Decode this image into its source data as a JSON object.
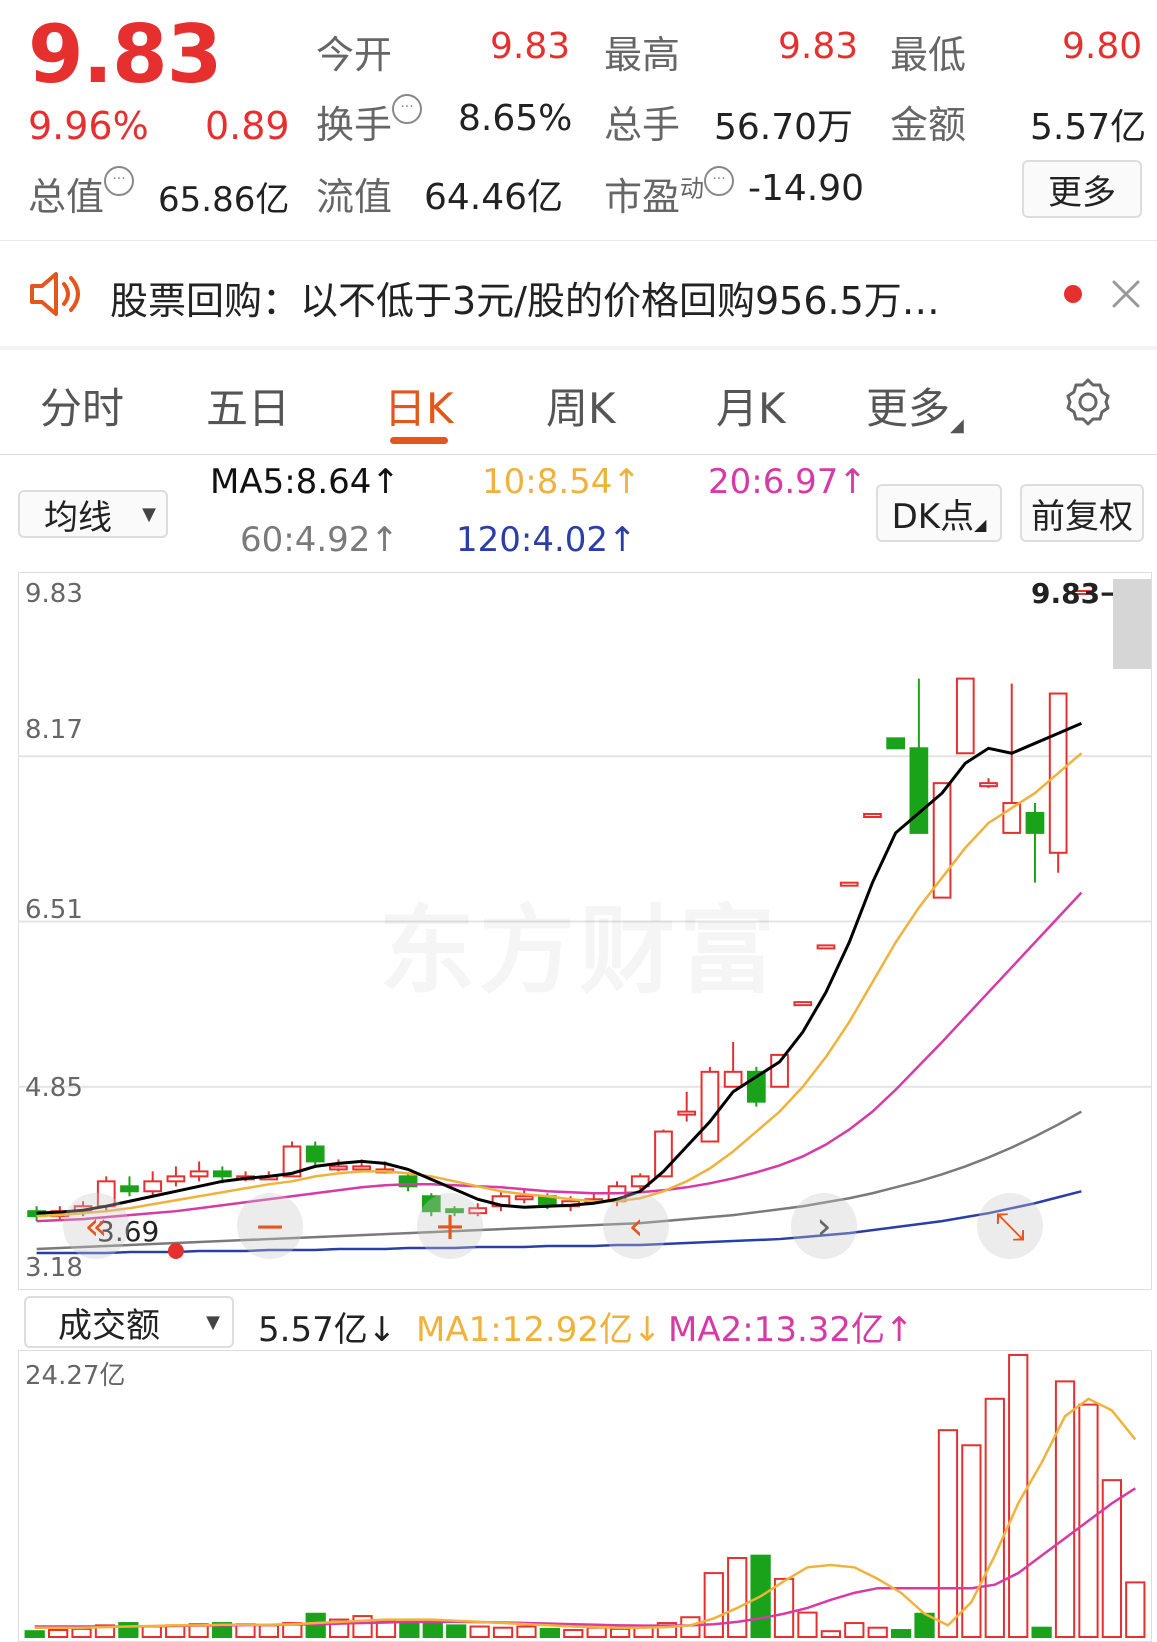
{
  "quote": {
    "price": "9.83",
    "change_pct": "9.96%",
    "change": "0.89",
    "open_label": "今开",
    "open": "9.83",
    "high_label": "最高",
    "high": "9.83",
    "low_label": "最低",
    "low": "9.80",
    "turnover_label": "换手",
    "turnover": "8.65%",
    "volume_label": "总手",
    "volume": "56.70万",
    "amount_label": "金额",
    "amount": "5.57亿",
    "mktcap_label": "总值",
    "mktcap": "65.86亿",
    "float_label": "流值",
    "float_cap": "64.46亿",
    "pe_label": "市盈",
    "pe_sup": "动",
    "pe": "-14.90",
    "more_label": "更多"
  },
  "notice": {
    "text": "股票回购：以不低于3元/股的价格回购956.5万…",
    "speaker_icon": "speaker-icon",
    "close_icon": "close-icon"
  },
  "tabs": [
    {
      "label": "分时"
    },
    {
      "label": "五日"
    },
    {
      "label": "日K"
    },
    {
      "label": "周K"
    },
    {
      "label": "月K"
    },
    {
      "label": "更多"
    }
  ],
  "active_tab": 2,
  "ma_bar": {
    "selector": "均线",
    "ma5": "MA5:8.64",
    "ma10": "10:8.54",
    "ma20": "20:6.97",
    "ma60": "60:4.92",
    "ma120": "120:4.02",
    "dk_label": "DK点",
    "fq_label": "前复权",
    "arrow_up": "↑"
  },
  "price_chart": {
    "y_labels": [
      "9.83",
      "8.17",
      "6.51",
      "4.85",
      "3.18"
    ],
    "max_label": "9.83",
    "min_label": "3.69",
    "watermark": "东方财富"
  },
  "volume_bar": {
    "selector": "成交额",
    "value": "5.57亿",
    "ma1": "MA1:12.92亿",
    "ma2": "MA2:13.32亿",
    "down_arrow": "↓",
    "up_arrow": "↑",
    "max_label": "24.27亿"
  },
  "colors": {
    "up": "#e6302f",
    "down": "#1aa31a",
    "ma5": "#000000",
    "ma10": "#f0b23c",
    "ma20": "#d63aa4",
    "ma60": "#7a7a7a",
    "ma120": "#2a3ea8",
    "accent": "#e4571c"
  },
  "chart_data": {
    "type": "candlestick",
    "y_range": [
      3.18,
      9.83
    ],
    "candles": [
      {
        "o": 3.6,
        "c": 3.55,
        "h": 3.65,
        "l": 3.5
      },
      {
        "o": 3.55,
        "c": 3.6,
        "h": 3.65,
        "l": 3.5
      },
      {
        "o": 3.6,
        "c": 3.65,
        "h": 3.7,
        "l": 3.55
      },
      {
        "o": 3.65,
        "c": 3.9,
        "h": 3.95,
        "l": 3.6
      },
      {
        "o": 3.85,
        "c": 3.8,
        "h": 3.95,
        "l": 3.75
      },
      {
        "o": 3.8,
        "c": 3.9,
        "h": 4.0,
        "l": 3.75
      },
      {
        "o": 3.9,
        "c": 3.95,
        "h": 4.05,
        "l": 3.85
      },
      {
        "o": 3.95,
        "c": 4.0,
        "h": 4.1,
        "l": 3.9
      },
      {
        "o": 4.0,
        "c": 3.95,
        "h": 4.05,
        "l": 3.88
      },
      {
        "o": 3.95,
        "c": 3.95,
        "h": 4.0,
        "l": 3.9
      },
      {
        "o": 3.95,
        "c": 3.95,
        "h": 4.0,
        "l": 3.92
      },
      {
        "o": 3.95,
        "c": 4.25,
        "h": 4.3,
        "l": 3.95
      },
      {
        "o": 4.25,
        "c": 4.1,
        "h": 4.3,
        "l": 4.05
      },
      {
        "o": 4.05,
        "c": 4.05,
        "h": 4.12,
        "l": 4.0
      },
      {
        "o": 4.05,
        "c": 4.05,
        "h": 4.12,
        "l": 4.0
      },
      {
        "o": 4.02,
        "c": 4.02,
        "h": 4.1,
        "l": 3.98
      },
      {
        "o": 3.95,
        "c": 3.85,
        "h": 3.98,
        "l": 3.8
      },
      {
        "o": 3.75,
        "c": 3.6,
        "h": 3.78,
        "l": 3.55
      },
      {
        "o": 3.62,
        "c": 3.6,
        "h": 3.65,
        "l": 3.55
      },
      {
        "o": 3.58,
        "c": 3.63,
        "h": 3.68,
        "l": 3.55
      },
      {
        "o": 3.65,
        "c": 3.75,
        "h": 3.8,
        "l": 3.6
      },
      {
        "o": 3.72,
        "c": 3.75,
        "h": 3.82,
        "l": 3.68
      },
      {
        "o": 3.75,
        "c": 3.65,
        "h": 3.78,
        "l": 3.62
      },
      {
        "o": 3.65,
        "c": 3.7,
        "h": 3.75,
        "l": 3.6
      },
      {
        "o": 3.72,
        "c": 3.72,
        "h": 3.78,
        "l": 3.68
      },
      {
        "o": 3.7,
        "c": 3.85,
        "h": 3.9,
        "l": 3.65
      },
      {
        "o": 3.85,
        "c": 3.95,
        "h": 3.98,
        "l": 3.82
      },
      {
        "o": 3.95,
        "c": 4.4,
        "h": 4.42,
        "l": 3.95
      },
      {
        "o": 4.6,
        "c": 4.6,
        "h": 4.8,
        "l": 4.5
      },
      {
        "o": 4.3,
        "c": 5.0,
        "h": 5.05,
        "l": 4.3
      },
      {
        "o": 4.85,
        "c": 5.0,
        "h": 5.3,
        "l": 4.85
      },
      {
        "o": 5.0,
        "c": 4.7,
        "h": 5.05,
        "l": 4.65
      },
      {
        "o": 4.85,
        "c": 5.17,
        "h": 5.17,
        "l": 4.85
      },
      {
        "o": 5.7,
        "c": 5.7,
        "h": 5.7,
        "l": 5.7
      },
      {
        "o": 6.27,
        "c": 6.27,
        "h": 6.27,
        "l": 6.27
      },
      {
        "o": 6.9,
        "c": 6.9,
        "h": 6.9,
        "l": 6.9
      },
      {
        "o": 7.59,
        "c": 7.59,
        "h": 7.59,
        "l": 7.59
      },
      {
        "o": 8.35,
        "c": 8.25,
        "h": 8.35,
        "l": 8.25
      },
      {
        "o": 8.25,
        "c": 7.4,
        "h": 8.95,
        "l": 7.4
      },
      {
        "o": 6.75,
        "c": 7.9,
        "h": 7.9,
        "l": 6.75
      },
      {
        "o": 8.2,
        "c": 8.95,
        "h": 8.95,
        "l": 8.2
      },
      {
        "o": 7.9,
        "c": 7.9,
        "h": 7.95,
        "l": 7.85
      },
      {
        "o": 7.4,
        "c": 7.7,
        "h": 8.9,
        "l": 7.4
      },
      {
        "o": 7.6,
        "c": 7.4,
        "h": 7.7,
        "l": 6.9
      },
      {
        "o": 7.2,
        "c": 8.8,
        "h": 8.8,
        "l": 7.0
      },
      {
        "o": 9.8,
        "c": 9.83,
        "h": 9.83,
        "l": 9.8
      }
    ],
    "ma5": [
      3.58,
      3.59,
      3.61,
      3.65,
      3.7,
      3.75,
      3.8,
      3.85,
      3.9,
      3.93,
      3.95,
      3.98,
      4.05,
      4.08,
      4.1,
      4.08,
      4.02,
      3.92,
      3.82,
      3.72,
      3.66,
      3.64,
      3.65,
      3.66,
      3.68,
      3.72,
      3.8,
      4.0,
      4.25,
      4.5,
      4.8,
      4.95,
      5.1,
      5.4,
      5.8,
      6.3,
      6.9,
      7.4,
      7.6,
      7.8,
      8.1,
      8.25,
      8.2,
      8.3,
      8.4,
      8.5
    ],
    "ma10": [
      3.55,
      3.56,
      3.58,
      3.6,
      3.63,
      3.67,
      3.71,
      3.75,
      3.79,
      3.83,
      3.87,
      3.9,
      3.95,
      3.98,
      4.0,
      4.0,
      3.98,
      3.95,
      3.9,
      3.85,
      3.8,
      3.77,
      3.75,
      3.72,
      3.7,
      3.7,
      3.73,
      3.8,
      3.9,
      4.03,
      4.2,
      4.4,
      4.6,
      4.85,
      5.15,
      5.5,
      5.9,
      6.3,
      6.65,
      6.95,
      7.25,
      7.5,
      7.65,
      7.8,
      8.0,
      8.2
    ],
    "ma20": [
      3.5,
      3.51,
      3.52,
      3.54,
      3.56,
      3.58,
      3.6,
      3.63,
      3.66,
      3.69,
      3.72,
      3.75,
      3.78,
      3.81,
      3.84,
      3.86,
      3.87,
      3.87,
      3.86,
      3.85,
      3.84,
      3.82,
      3.8,
      3.79,
      3.78,
      3.78,
      3.79,
      3.81,
      3.84,
      3.88,
      3.93,
      3.99,
      4.06,
      4.15,
      4.27,
      4.42,
      4.6,
      4.82,
      5.06,
      5.3,
      5.55,
      5.8,
      6.05,
      6.3,
      6.55,
      6.8
    ],
    "ma60": [
      3.22,
      3.23,
      3.24,
      3.25,
      3.26,
      3.27,
      3.28,
      3.29,
      3.3,
      3.31,
      3.32,
      3.33,
      3.34,
      3.35,
      3.36,
      3.37,
      3.38,
      3.39,
      3.4,
      3.41,
      3.42,
      3.43,
      3.44,
      3.45,
      3.46,
      3.47,
      3.48,
      3.5,
      3.52,
      3.54,
      3.56,
      3.59,
      3.62,
      3.65,
      3.69,
      3.73,
      3.78,
      3.84,
      3.9,
      3.97,
      4.05,
      4.14,
      4.24,
      4.35,
      4.47,
      4.6
    ],
    "ma120": [
      3.18,
      3.18,
      3.18,
      3.18,
      3.19,
      3.19,
      3.19,
      3.2,
      3.2,
      3.2,
      3.21,
      3.21,
      3.21,
      3.22,
      3.22,
      3.22,
      3.23,
      3.23,
      3.23,
      3.24,
      3.24,
      3.24,
      3.25,
      3.25,
      3.25,
      3.26,
      3.26,
      3.27,
      3.28,
      3.29,
      3.3,
      3.31,
      3.32,
      3.34,
      3.36,
      3.38,
      3.41,
      3.44,
      3.47,
      3.5,
      3.54,
      3.58,
      3.63,
      3.68,
      3.74,
      3.8
    ],
    "volumes": [
      0.5,
      0.6,
      0.7,
      1.0,
      1.2,
      0.9,
      1.0,
      1.1,
      1.2,
      1.1,
      1.0,
      1.2,
      2.0,
      1.5,
      1.8,
      1.4,
      1.2,
      1.3,
      1.0,
      0.9,
      0.8,
      0.9,
      0.7,
      0.6,
      0.8,
      0.7,
      0.9,
      1.2,
      1.7,
      5.5,
      6.8,
      7.0,
      5.0,
      2.1,
      0.5,
      1.2,
      0.8,
      0.6,
      2.0,
      17.8,
      16.5,
      20.5,
      24.27,
      0.8,
      22.0,
      20.0,
      13.5,
      4.7
    ],
    "vol_ma1": [
      0.8,
      0.8,
      0.8,
      0.85,
      0.9,
      0.95,
      1.0,
      1.0,
      1.05,
      1.05,
      1.05,
      1.1,
      1.2,
      1.3,
      1.4,
      1.5,
      1.5,
      1.5,
      1.4,
      1.3,
      1.2,
      1.1,
      1.0,
      0.9,
      0.85,
      0.8,
      0.8,
      0.85,
      1.0,
      1.6,
      2.5,
      3.5,
      4.8,
      6.0,
      6.2,
      6.0,
      5.0,
      3.8,
      2.0,
      1.0,
      3.0,
      7.0,
      11.5,
      15.0,
      19.0,
      20.5,
      19.5,
      17.0
    ],
    "vol_ma2": [
      0.9,
      0.9,
      0.9,
      0.9,
      0.9,
      0.92,
      0.95,
      0.98,
      1.0,
      1.02,
      1.05,
      1.08,
      1.1,
      1.15,
      1.2,
      1.25,
      1.3,
      1.3,
      1.3,
      1.28,
      1.25,
      1.2,
      1.15,
      1.1,
      1.05,
      1.0,
      0.98,
      0.98,
      1.0,
      1.1,
      1.3,
      1.6,
      2.0,
      2.5,
      3.2,
      3.8,
      4.2,
      4.2,
      4.2,
      4.2,
      4.2,
      4.5,
      5.5,
      7.0,
      8.5,
      10.0,
      11.5,
      12.8
    ]
  }
}
